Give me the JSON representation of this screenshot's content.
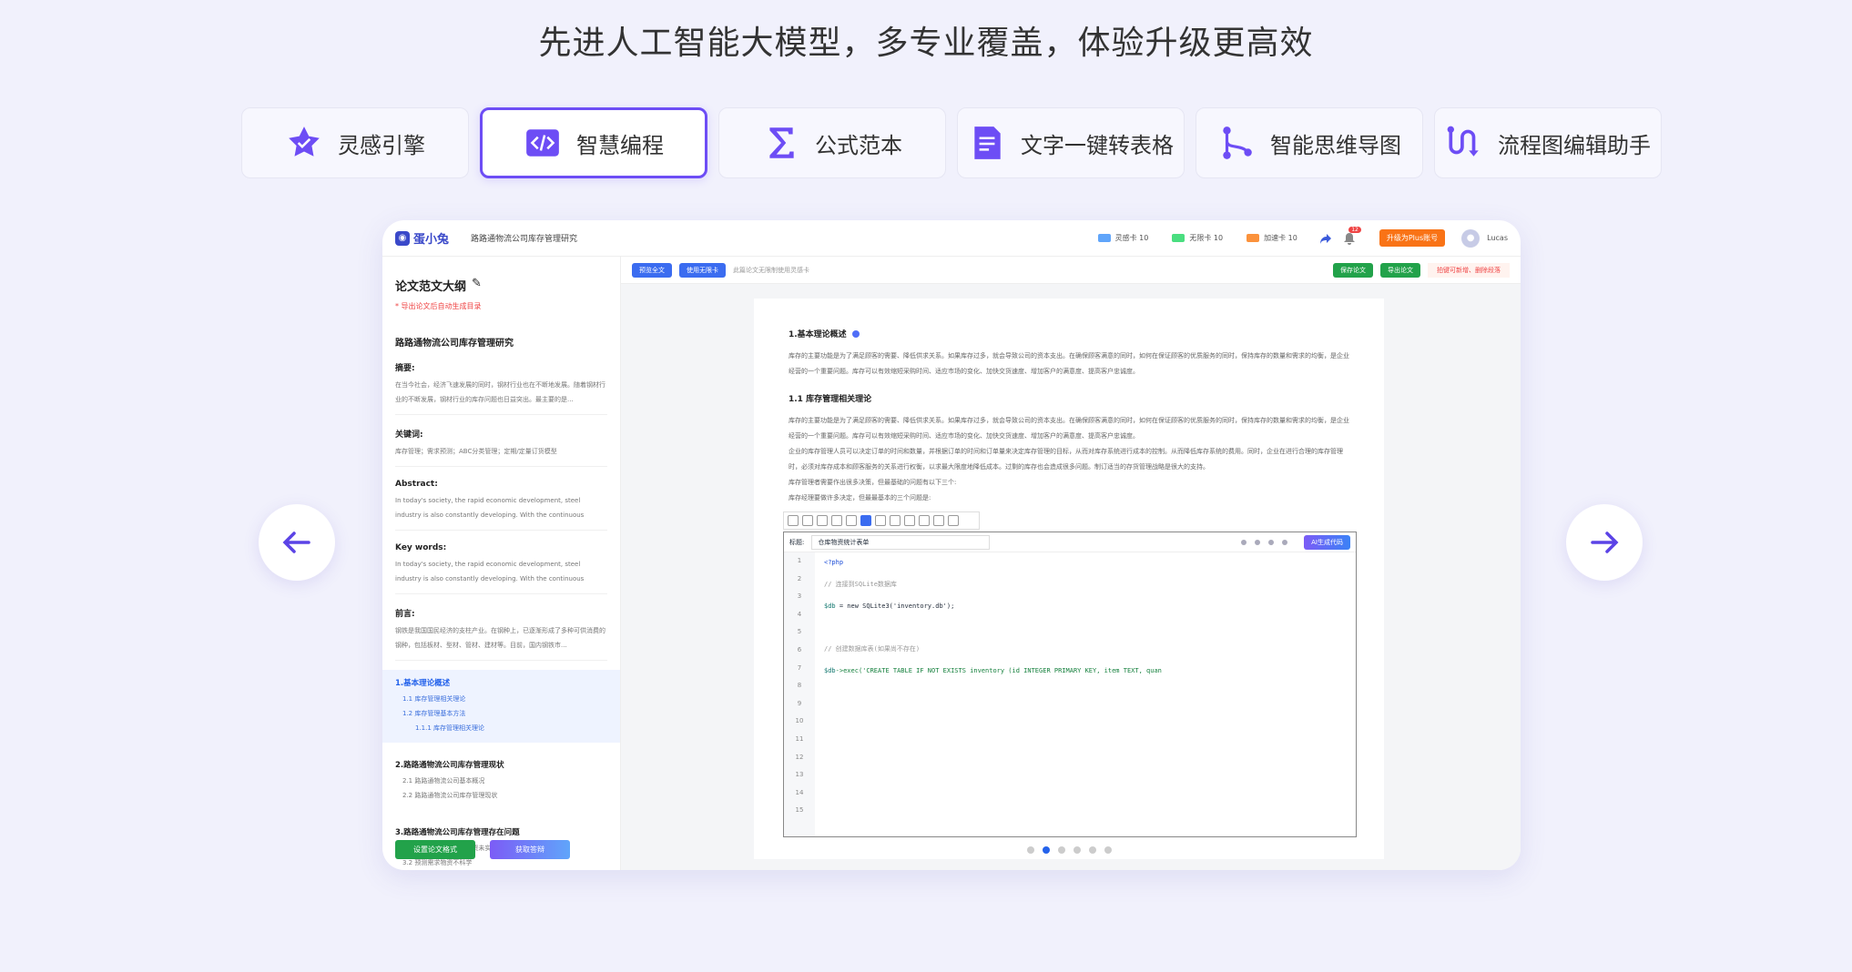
{
  "headline": "先进人工智能大模型，多专业覆盖，体验升级更高效",
  "tabs": [
    {
      "label": "灵感引擎",
      "icon": "star-badge-icon"
    },
    {
      "label": "智慧编程",
      "icon": "code-icon",
      "active": true
    },
    {
      "label": "公式范本",
      "icon": "sigma-icon"
    },
    {
      "label": "文字一键转表格",
      "icon": "document-icon"
    },
    {
      "label": "智能思维导图",
      "icon": "mindmap-icon"
    },
    {
      "label": "流程图编辑助手",
      "icon": "flowchart-icon"
    }
  ],
  "app": {
    "logo": "蛋小兔",
    "paper_title": "路路通物流公司库存管理研究",
    "counters": [
      {
        "label": "灵感卡 10",
        "color": "#60a5fa"
      },
      {
        "label": "无限卡 10",
        "color": "#4ade80"
      },
      {
        "label": "加速卡 10",
        "color": "#fb923c"
      }
    ],
    "bell_count": "12",
    "upgrade_label": "升级为Plus账号",
    "user_name": "Lucas"
  },
  "sidebar": {
    "title": "论文范文大纲",
    "note": "* 导出论文后自动生成目录",
    "paper": "路路通物流公司库存管理研究",
    "sections": [
      {
        "title": "摘要:",
        "text": "在当今社会，经济飞速发展的同时，钢材行业也在不断地发展。随着钢材行业的不断发展，钢材行业的库存问题也日益突出。最主要的是..."
      },
      {
        "title": "关键词:",
        "text": "库存管理；需求预测；ABC分类管理；定期/定量订货模型"
      },
      {
        "title": "Abstract:",
        "text": "In today's society, the rapid economic development, steel industry is also constantly developing. With the continuous"
      },
      {
        "title": "Key words:",
        "text": "In today's society, the rapid economic development, steel industry is also constantly developing. With the continuous"
      },
      {
        "title": "前言:",
        "text": "钢铁是我国国民经济的支柱产业。在钢种上，已逐渐形成了多种可供消费的钢种，包括板材、型材、管材、建材等。目前，国内钢铁市..."
      }
    ],
    "toc": [
      {
        "title": "1.基本理论概述",
        "items": [
          "1.1 库存管理相关理论",
          "1.2 库存管理基本方法",
          "1.1.1 库存管理相关理论"
        ]
      },
      {
        "title": "2.路路通物流公司库存管理现状",
        "items": [
          "2.1 路路通物流公司基本概况",
          "2.2 路路通物流公司库存管理现状"
        ]
      },
      {
        "title": "3.路路通物流公司库存管理存在问题",
        "items": [
          "3.1 物资摆放不合理、物资未实施分类管理",
          "3.2 预测需求物资不科学"
        ]
      }
    ],
    "btn_format": "设置论文格式",
    "btn_ppt": "获取答辩"
  },
  "toolbar": {
    "preview": "预览全文",
    "unlimited": "使用无限卡",
    "hint": "此篇论文无限制使用灵感卡",
    "save": "保存论文",
    "export": "导出论文",
    "warn": "拍键可新增、删除段落"
  },
  "doc": {
    "h1": "1.基本理论概述",
    "p1": "库存的主要功能是为了满足顾客的需要、降低供求关系。如果库存过多，就会导致公司的资本支出。在确保顾客满意的同时，如何在保证顾客的优质服务的同时，保持库存的数量和需求的均衡，是企业经营的一个重要问题。库存可以有效缩短采购时间、适应市场的变化、加快交货速度、增加客户的满意度、提高客户忠诚度。",
    "h2": "1.1 库存管理相关理论",
    "p2": "库存的主要功能是为了满足顾客的需要、降低供求关系。如果库存过多，就会导致公司的资本支出。在确保顾客满意的同时，如何在保证顾客的优质服务的同时，保持库存的数量和需求的均衡，是企业经营的一个重要问题。库存可以有效缩短采购时间、适应市场的变化、加快交货速度、增加客户的满意度、提高客户忠诚度。",
    "p3": "企业的库存管理人员可以决定订单的时间和数量，并根据订单的时间和订单量来决定库存管理的目标，从而对库存系统进行成本的控制。从而降低库存系统的费用。同时，企业在进行合理的库存管理时，必须对库存成本和顾客服务的关系进行权衡，以求最大限度地降低成本。过剩的库存也会造成很多问题。制订适当的存货管理战略是很大的支持。",
    "p4": "库存管理者需要作出很多决策，但最基础的问题有以下三个:",
    "p5": "库存经理要做许多决定，但最最基本的三个问题是:",
    "code_label": "标题:",
    "code_title": "仓库物资统计表单",
    "ai_btn": "AI生成代码",
    "line_numbers": [
      "1",
      "2",
      "3",
      "4",
      "5",
      "6",
      "7",
      "8",
      "9",
      "10",
      "11",
      "12",
      "13",
      "14",
      "15"
    ],
    "code": {
      "l1": "<?php",
      "l2": "// 连接到SQLite数据库",
      "l3a": "$db",
      "l3b": " = new SQLite3('inventory.db');",
      "l5": "// 创建数据库表(如果尚不存在)",
      "l6a": "$db",
      "l6b": "->exec('CREATE TABLE IF NOT EXISTS inventory (id INTEGER PRIMARY KEY, item TEXT, quan"
    }
  }
}
